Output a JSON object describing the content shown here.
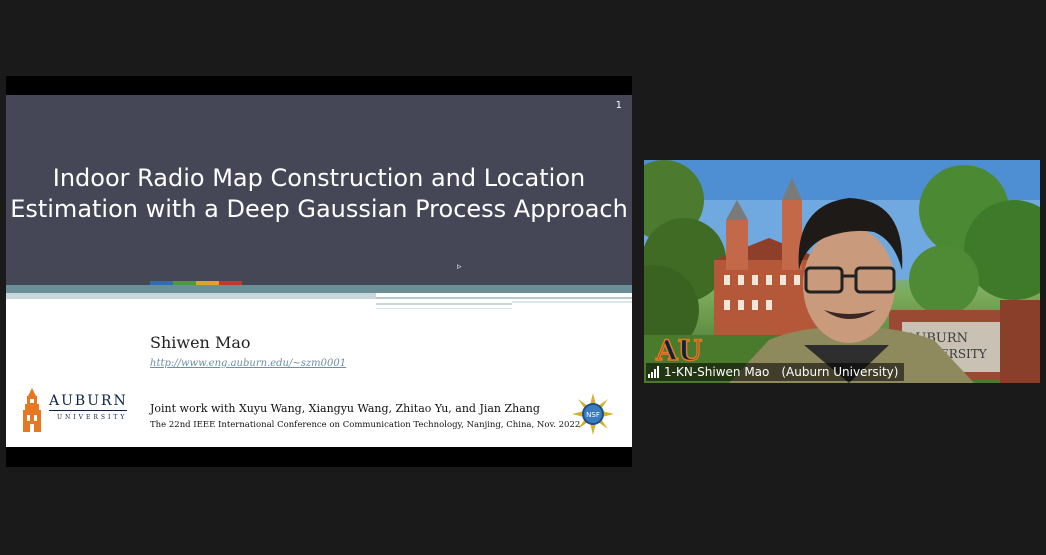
{
  "slide": {
    "number": "1",
    "title_line1": "Indoor Radio Map Construction and Location",
    "title_line2": "Estimation with a Deep Gaussian Process Approach",
    "author": "Shiwen Mao",
    "url": "http://www.eng.auburn.edu/~szm0001",
    "joint_work": "Joint work with Xuyu Wang, Xiangyu Wang, Zhitao Yu, and Jian Zhang",
    "conference": "The 22nd IEEE International Conference on Communication Technology, Nanjing, China, Nov. 2022",
    "logo_auburn": "AUBURN",
    "logo_auburn_sub": "UNIVERSITY",
    "logo_nsf": "NSF",
    "accent_colors": [
      "#2e6db5",
      "#4c9a3b",
      "#e0a22e",
      "#c0392b"
    ]
  },
  "video": {
    "participant_name": "1-KN-Shiwen Mao",
    "participant_org": "(Auburn University)",
    "background_sign_text": "AUBURN UNIVERSITY",
    "background_logo_text": "AU"
  },
  "colors": {
    "meeting_background": "#1a1a1a",
    "slide_header": "#454757",
    "auburn_navy": "#0c2340",
    "auburn_orange": "#e87722"
  }
}
